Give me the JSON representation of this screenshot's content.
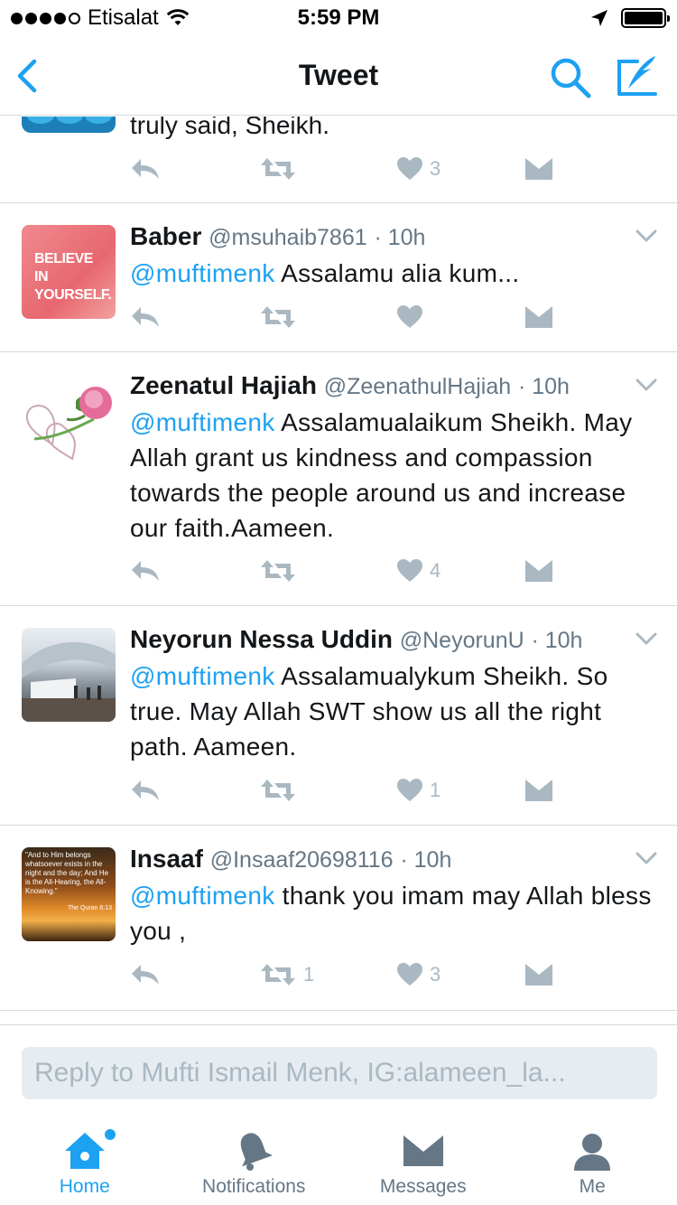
{
  "status_bar": {
    "carrier": "Etisalat",
    "time": "5:59 PM"
  },
  "nav": {
    "title": "Tweet"
  },
  "partial_tweet": {
    "text": "truly said, Sheikh.",
    "likes": "3"
  },
  "tweets": [
    {
      "name": "Baber",
      "handle": "@msuhaib7861",
      "time": "· 10h",
      "mention": "@muftimenk",
      "text": " Assalamu alia kum...",
      "retweets": "",
      "likes": "",
      "avatar_caption": "BELIEVE IN YOURSELF."
    },
    {
      "name": "Zeenatul Hajiah",
      "handle": "@ZeenathulHajiah",
      "time": "· 10h",
      "mention": "@muftimenk",
      "text": " Assalamualaikum Sheikh. May Allah grant us kindness and compassion  towards the people around us and increase our faith.Aameen.",
      "retweets": "",
      "likes": "4"
    },
    {
      "name": "Neyorun Nessa Uddin",
      "handle": "@NeyorunU",
      "time": "· 10h",
      "mention": "@muftimenk",
      "text": " Assalamualykum Sheikh. So true. May Allah SWT show us all the right path. Aameen.",
      "retweets": "",
      "likes": "1"
    },
    {
      "name": "Insaaf",
      "handle": "@Insaaf20698116",
      "time": "· 10h",
      "mention": "@muftimenk",
      "text": " thank you imam may Allah bless you ,",
      "retweets": "1",
      "likes": "3",
      "avatar_caption": "\"And to Him belongs whatsoever exists in the night and the day; And He is the All-Hearing, the All-Knowing.\"",
      "avatar_ref": "The Quran 6:13"
    }
  ],
  "reply": {
    "placeholder": "Reply to Mufti Ismail Menk, IG:alameen_la..."
  },
  "tabs": [
    {
      "label": "Home",
      "icon": "home-icon"
    },
    {
      "label": "Notifications",
      "icon": "bell-icon"
    },
    {
      "label": "Messages",
      "icon": "envelope-icon"
    },
    {
      "label": "Me",
      "icon": "person-icon"
    }
  ],
  "colors": {
    "accent": "#1da1f2",
    "icon_gray": "#aab8c2",
    "text_gray": "#657786",
    "divider": "#d6d9db"
  }
}
